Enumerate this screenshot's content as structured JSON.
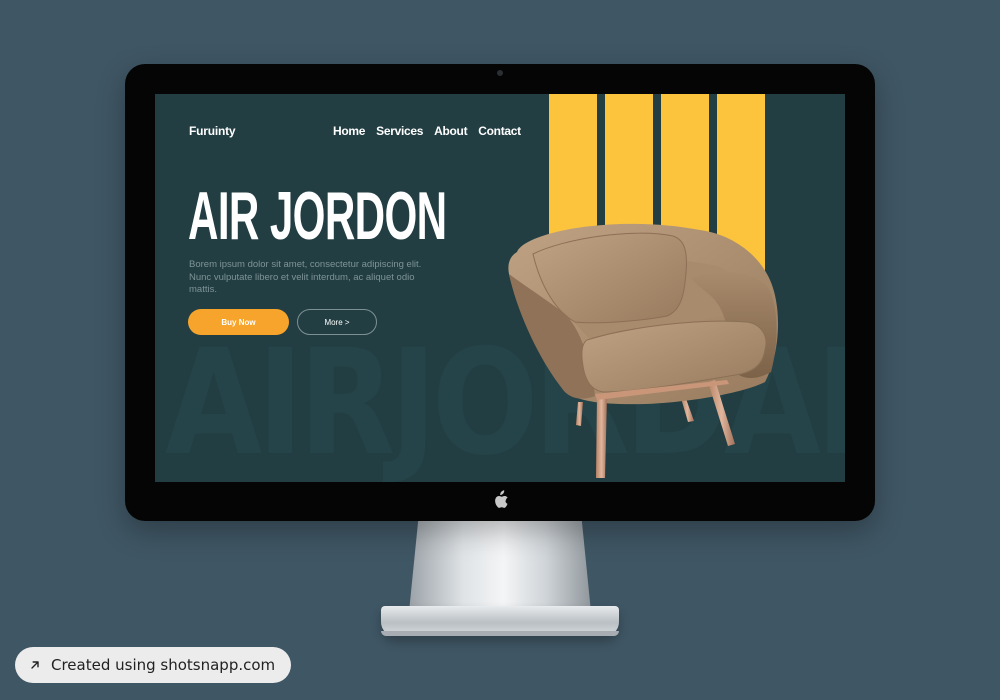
{
  "site": {
    "brand": "Furuinty",
    "nav": [
      {
        "label": "Home"
      },
      {
        "label": "Services"
      },
      {
        "label": "About"
      },
      {
        "label": "Contact"
      }
    ],
    "hero": {
      "title": "AIR JORDON",
      "description": "Borem ipsum dolor sit amet, consectetur adipiscing elit. Nunc vulputate libero et velit interdum, ac aliquet odio mattis.",
      "watermark": "AIRJORDAN",
      "buy_label": "Buy Now",
      "more_label": "More >"
    },
    "colors": {
      "background": "#223e42",
      "accent_stripes": "#fcc33c",
      "buy_button": "#f6a42c",
      "text_primary": "#ffffff",
      "text_muted": "#7e9497"
    }
  },
  "device": {
    "type": "desktop monitor",
    "logo_icon": "apple-logo-icon"
  },
  "badge": {
    "label": "Created using shotsnapp.com",
    "icon": "arrow-up-right-icon"
  }
}
